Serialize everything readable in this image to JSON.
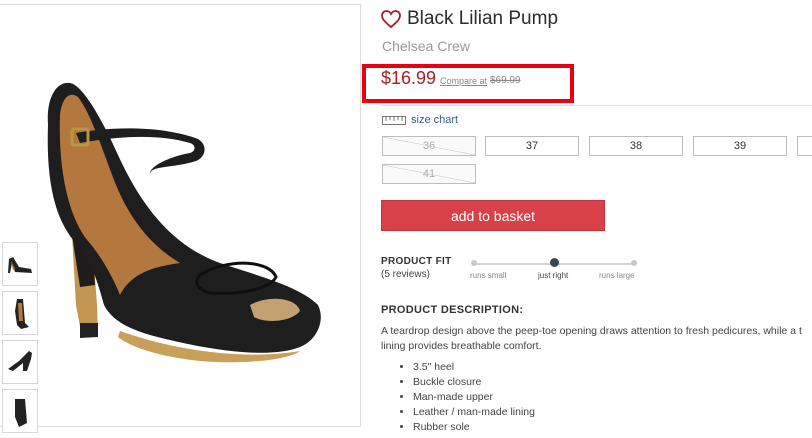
{
  "product": {
    "title": "Black Lilian Pump",
    "brand": "Chelsea Crew",
    "price": "$16.99",
    "compare_label": "Compare at",
    "compare_price": "$69.99"
  },
  "size_chart_label": "size chart",
  "sizes": [
    {
      "label": "36",
      "available": false
    },
    {
      "label": "37",
      "available": true
    },
    {
      "label": "38",
      "available": true
    },
    {
      "label": "39",
      "available": true
    },
    {
      "label": "41",
      "available": false
    }
  ],
  "add_to_basket_label": "add to basket",
  "product_fit": {
    "label": "PRODUCT FIT",
    "reviews": "(5 reviews)",
    "scale": [
      "runs small",
      "just right",
      "runs large"
    ],
    "selected": "just right"
  },
  "description": {
    "title": "PRODUCT DESCRIPTION:",
    "line1": "A teardrop design above the peep-toe opening draws attention to fresh pedicures, while a t",
    "line2": "lining provides breathable comfort.",
    "features": [
      "3.5\" heel",
      "Buckle closure",
      "Man-made upper",
      "Leather / man-made lining",
      "Rubber sole"
    ]
  },
  "colors": {
    "accent": "#d84148",
    "price": "#a51f24",
    "highlight": "#e60012",
    "link": "#3b5a8a"
  }
}
